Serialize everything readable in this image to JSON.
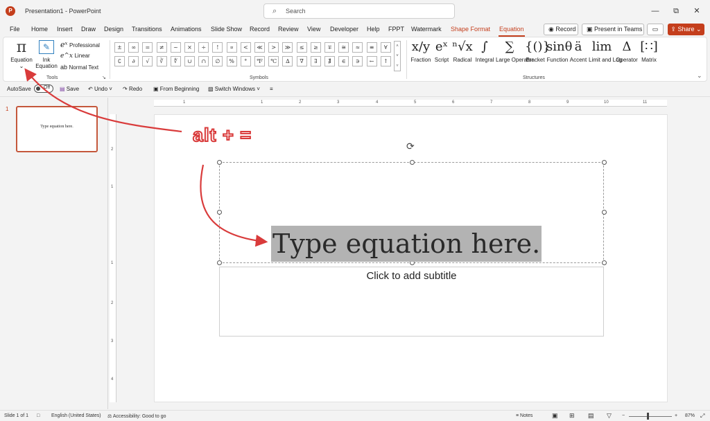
{
  "window": {
    "app_icon": "P",
    "title": "Presentation1 - PowerPoint",
    "search_placeholder": "Search",
    "minimize": "—",
    "restore": "⧉",
    "close": "✕"
  },
  "tabs": [
    "File",
    "Home",
    "Insert",
    "Draw",
    "Design",
    "Transitions",
    "Animations",
    "Slide Show",
    "Record",
    "Review",
    "View",
    "Developer",
    "Help",
    "FPPT",
    "Watermark",
    "Shape Format",
    "Equation"
  ],
  "top_buttons": {
    "record": "Record",
    "present_in_teams": "Present in Teams",
    "share": "Share"
  },
  "ribbon": {
    "tools": {
      "group_label": "Tools",
      "equation": "Equation",
      "ink_equation": "Ink Equation",
      "ink_line1": "Ink",
      "ink_line2": "Equation",
      "professional": "Professional",
      "linear": "Linear",
      "normal_text": "Normal Text"
    },
    "symbols": {
      "group_label": "Symbols",
      "row1": [
        "±",
        "∞",
        "=",
        "≠",
        "~",
        "×",
        "÷",
        "!",
        "∝",
        "<",
        "≪",
        ">",
        "≫",
        "≤",
        "≥",
        "∓",
        "≅",
        "≈",
        "≡",
        "∀"
      ],
      "row2": [
        "∁",
        "∂",
        "√",
        "∛",
        "∜",
        "∪",
        "∩",
        "∅",
        "%",
        "°",
        "℉",
        "℃",
        "∆",
        "∇",
        "∃",
        "∄",
        "∈",
        "∋",
        "←",
        "↑"
      ]
    },
    "structures": {
      "group_label": "Structures",
      "items": [
        {
          "glyph": "x/y",
          "label": "Fraction"
        },
        {
          "glyph": "eˣ",
          "label": "Script"
        },
        {
          "glyph": "ⁿ√x",
          "label": "Radical"
        },
        {
          "glyph": "∫",
          "label": "Integral"
        },
        {
          "glyph": "∑",
          "label": "Large Operator"
        },
        {
          "glyph": "{()}",
          "label": "Bracket"
        },
        {
          "glyph": "sinθ",
          "label": "Function"
        },
        {
          "glyph": "ä",
          "label": "Accent"
        },
        {
          "glyph": "lim",
          "label": "Limit and Log"
        },
        {
          "glyph": "Δ",
          "label": "Operator"
        },
        {
          "glyph": "[∷]",
          "label": "Matrix"
        }
      ]
    }
  },
  "qat": {
    "autosave": "AutoSave",
    "autosave_state": "Off",
    "save": "Save",
    "undo": "Undo",
    "redo": "Redo",
    "from_beginning": "From Beginning",
    "switch_windows": "Switch Windows"
  },
  "thumbnail": {
    "number": "1",
    "text": "Type equation here."
  },
  "ruler": {
    "h": [
      "1",
      "1",
      "2",
      "3",
      "4",
      "5",
      "6",
      "7",
      "8",
      "9",
      "10",
      "11"
    ],
    "v": [
      "2",
      "1",
      "1",
      "2",
      "3",
      "4"
    ]
  },
  "slide": {
    "equation_placeholder": "Type equation here.",
    "subtitle_placeholder": "Click to add subtitle"
  },
  "annotation": {
    "text": "alt + =",
    "color": "#d93b3b"
  },
  "status": {
    "slide": "Slide 1 of 1",
    "language": "English (United States)",
    "accessibility": "Accessibility: Good to go",
    "notes": "Notes",
    "zoom": "87%"
  }
}
